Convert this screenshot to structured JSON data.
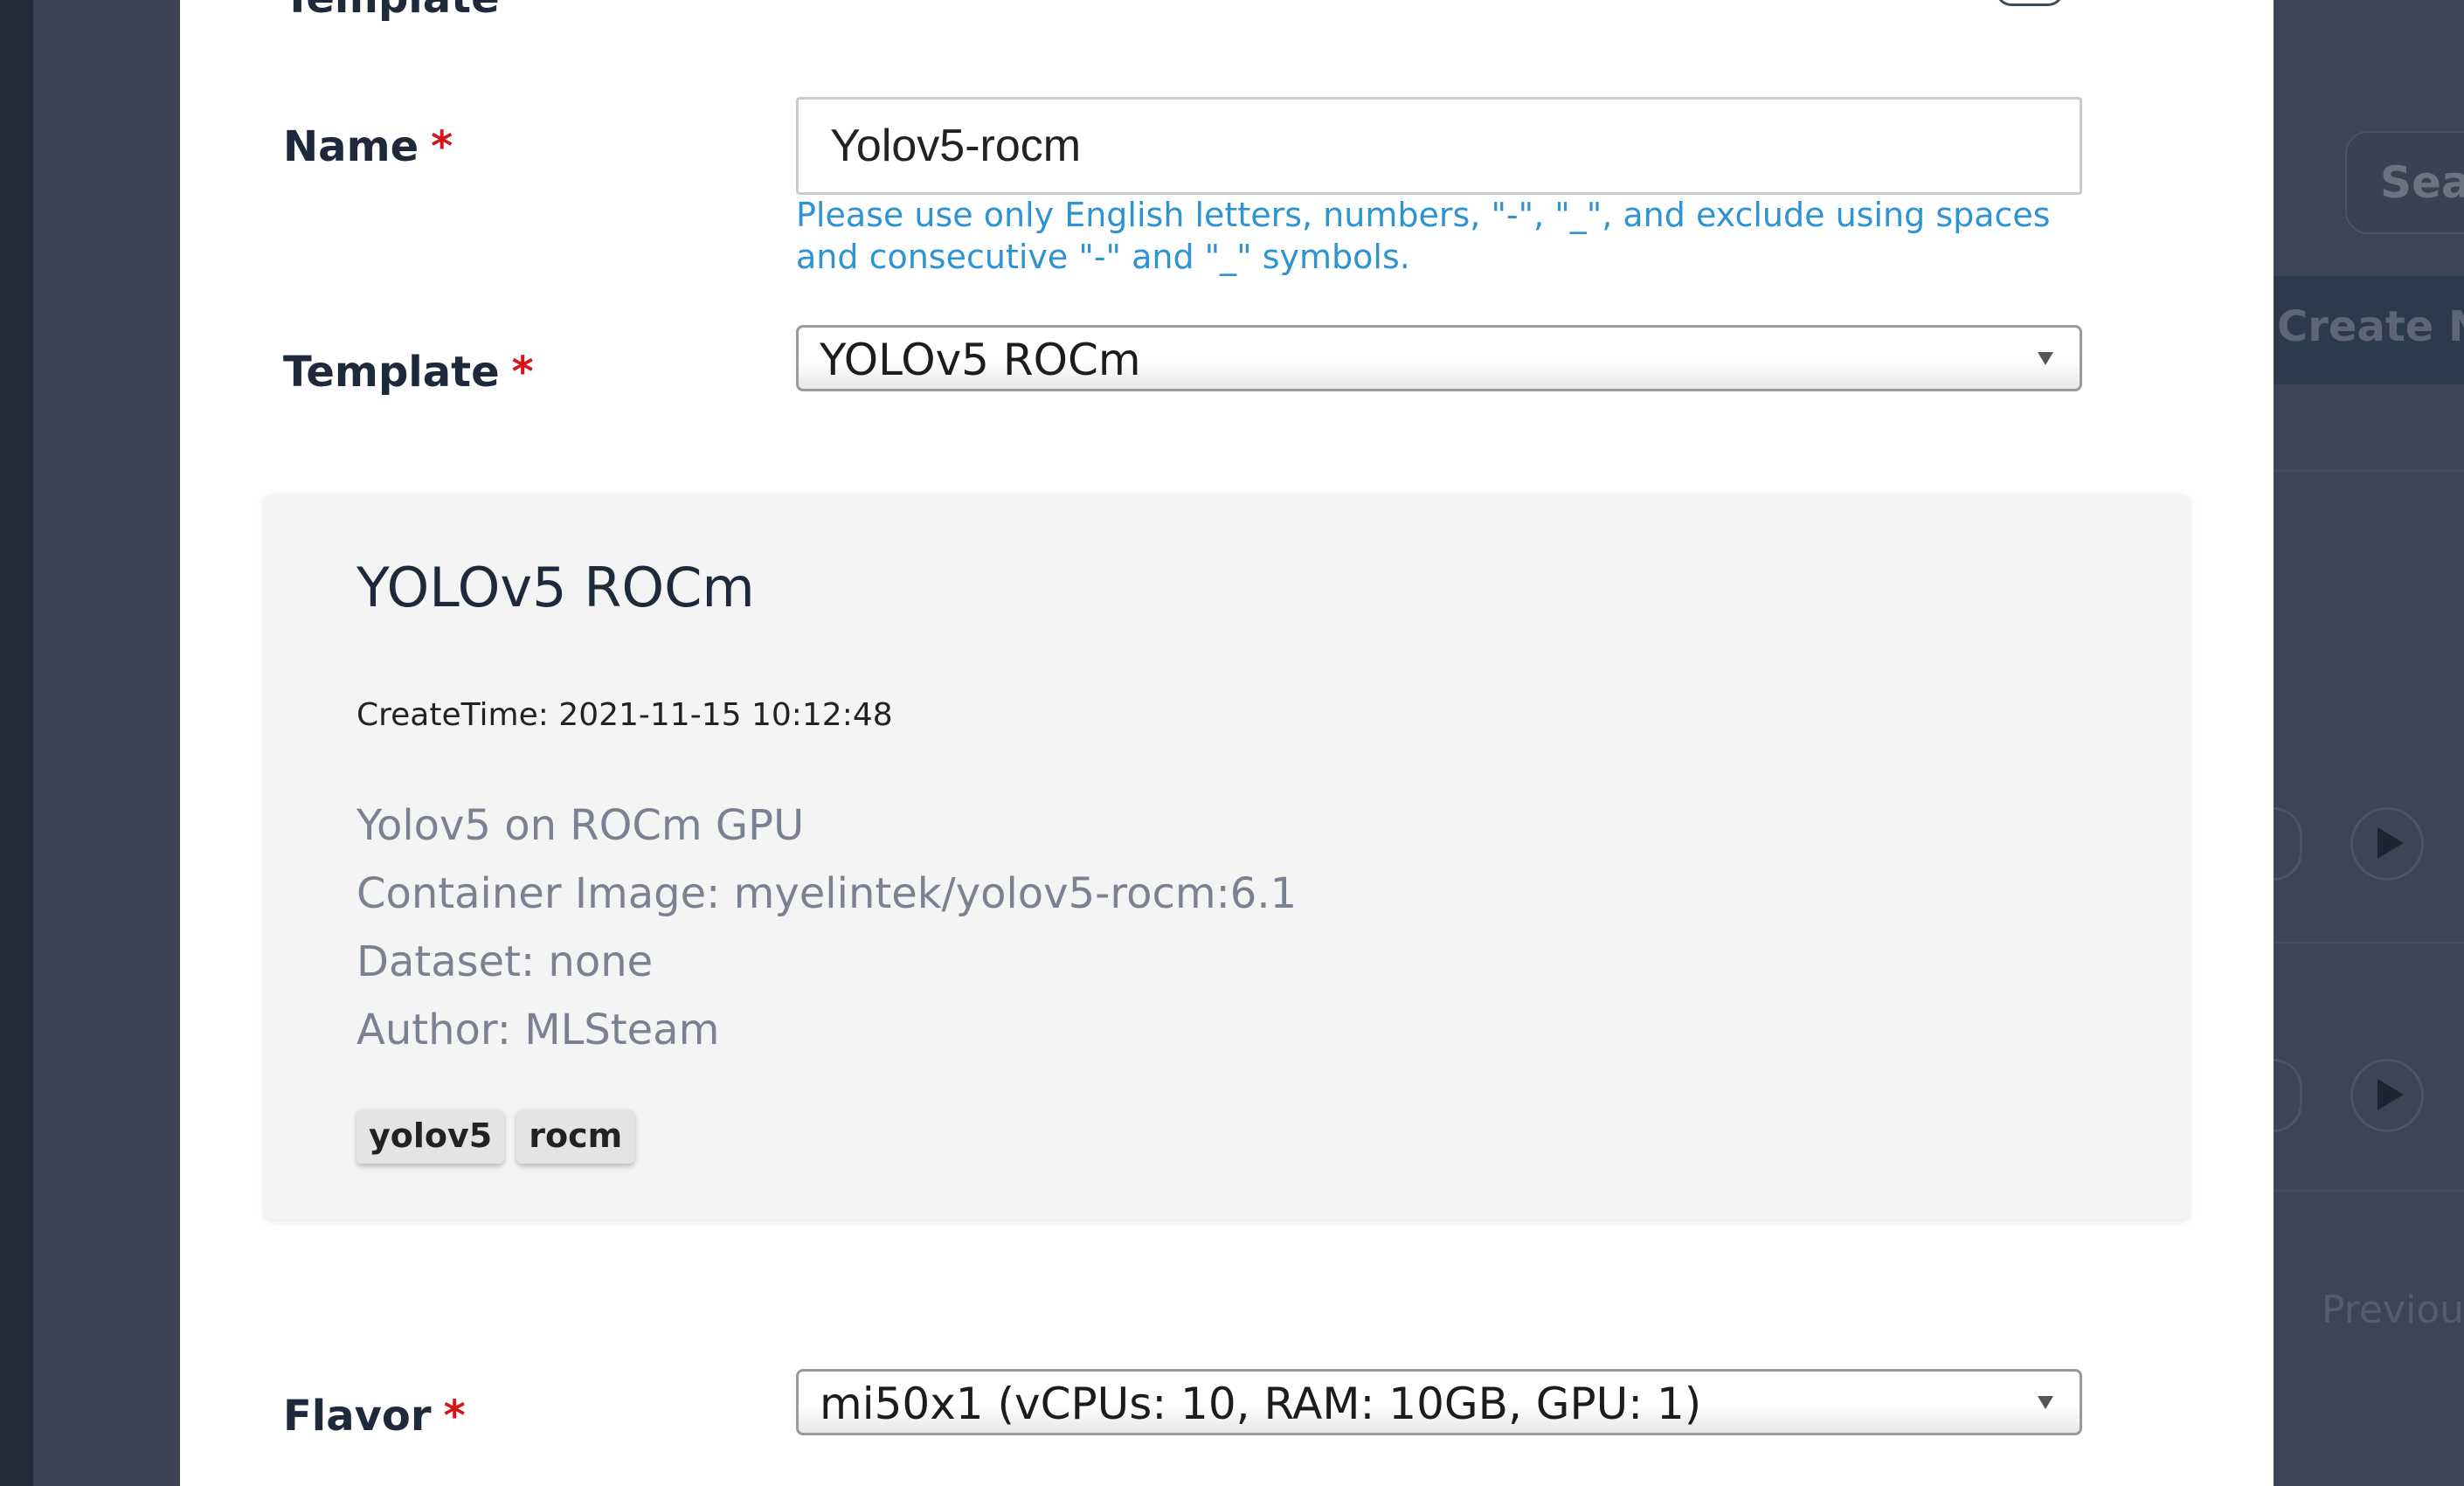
{
  "background": {
    "search_placeholder": "Sear",
    "create_button_label": "Create N",
    "previous_label": "Previou"
  },
  "form": {
    "name": {
      "label": "Name",
      "required_mark": "*",
      "value": "Yolov5-rocm",
      "help": "Please use only English letters, numbers, \"-\", \"_\", and exclude using spaces and consecutive \"-\" and \"_\" symbols."
    },
    "template": {
      "section_title_partial": "Template",
      "label": "Template",
      "required_mark": "*",
      "selected": "YOLOv5 ROCm"
    },
    "template_card": {
      "title": "YOLOv5 ROCm",
      "create_time": "CreateTime: 2021-11-15 10:12:48",
      "description": "Yolov5 on ROCm GPU",
      "container_image": "Container Image: myelintek/yolov5-rocm:6.1",
      "dataset": "Dataset: none",
      "author": "Author: MLSteam",
      "tags": [
        "yolov5",
        "rocm"
      ]
    },
    "flavor": {
      "label": "Flavor",
      "required_mark": "*",
      "selected": "mi50x1 (vCPUs: 10, RAM: 10GB, GPU: 1)"
    }
  }
}
